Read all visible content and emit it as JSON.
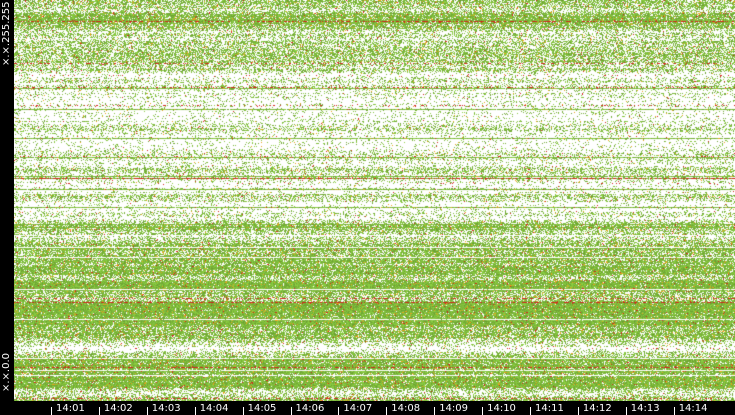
{
  "chart_data": {
    "type": "heatmap",
    "y_axis": {
      "top_label": "×.×.255.255",
      "bottom_label": "×.×.0.0"
    },
    "x_ticks": [
      "14:01",
      "14:02",
      "14:03",
      "14:04",
      "14:05",
      "14:06",
      "14:07",
      "14:08",
      "14:09",
      "14:10",
      "14:11",
      "14:12",
      "14:13",
      "14:14"
    ],
    "colors": {
      "background": "#ffffff",
      "low": "#7cb83a",
      "medium": "#e8a21a",
      "high": "#d0251a",
      "chrome": "#000000"
    }
  }
}
